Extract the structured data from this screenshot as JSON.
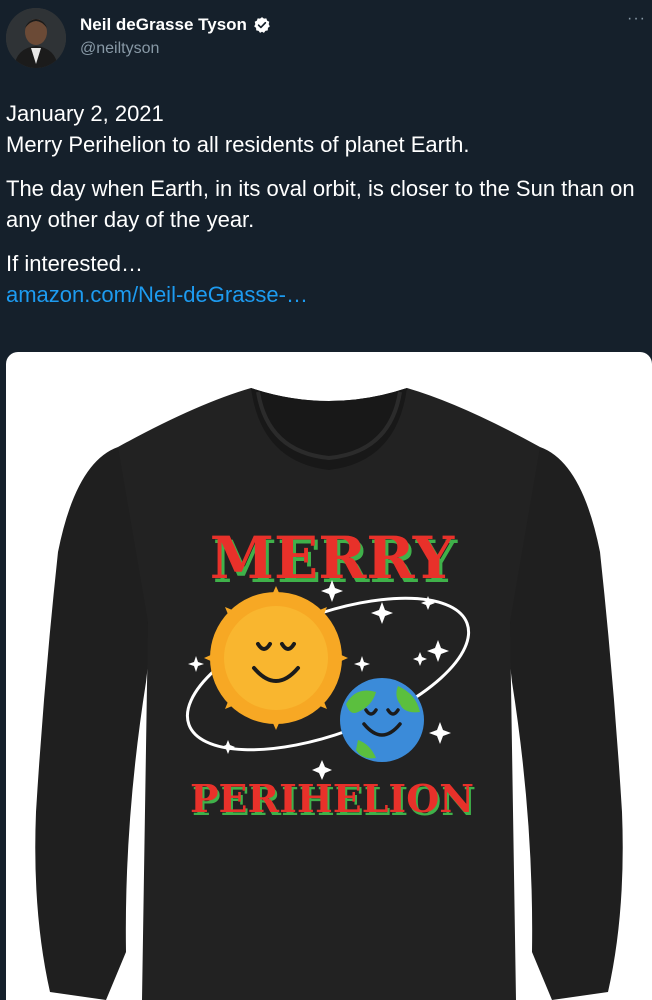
{
  "tweet": {
    "author_name": "Neil deGrasse Tyson",
    "handle": "@neiltyson",
    "more_label": "···",
    "date": "January 2, 2021",
    "line1": "Merry Perihelion to all residents of planet Earth.",
    "line2": "The day when Earth, in its oval orbit, is closer to the Sun than on any other day of the year.",
    "line3": "If interested…",
    "link_text": "amazon.com/Neil-deGrasse-…"
  },
  "shirt": {
    "top_text": "MERRY",
    "bottom_text": "PERIHELION"
  },
  "icons": {
    "verified": "verified-badge-icon",
    "more": "more-options-icon"
  },
  "colors": {
    "background": "#15202b",
    "link": "#1d9bf0",
    "secondary_text": "#8899a6",
    "shirt": "#1f1f1f",
    "text_red": "#e8312a",
    "text_green": "#3fb14a",
    "sun": "#f7a824",
    "earth_blue": "#3b8bd9",
    "earth_green": "#5bbf3e"
  }
}
